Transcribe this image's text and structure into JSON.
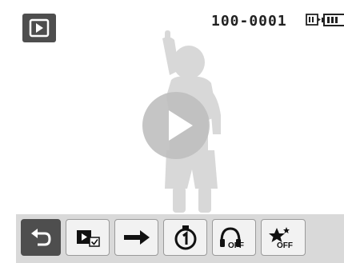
{
  "header": {
    "mode_icon": "play-mode-icon",
    "file_number": "100-0001",
    "storage_icon": "internal-memory-icon",
    "battery_icon": "battery-icon"
  },
  "preview": {
    "image": "child-silhouette",
    "play_icon": "play-icon"
  },
  "toolbar": {
    "items": [
      {
        "name": "back-button",
        "icon": "back-arrow-icon",
        "active": true
      },
      {
        "name": "slideshow-image-button",
        "icon": "image-select-icon"
      },
      {
        "name": "effect-button",
        "icon": "arrow-right-icon"
      },
      {
        "name": "interval-button",
        "icon": "timer-one-icon"
      },
      {
        "name": "music-button",
        "icon": "headphones-off-icon",
        "label": "OFF"
      },
      {
        "name": "transition-effect-button",
        "icon": "star-off-icon",
        "label": "OFF"
      }
    ]
  },
  "colors": {
    "active": "#4e4e4e",
    "toolbar_bg": "#d9d9d9",
    "button_bg": "#f2f2f2",
    "silhouette": "#d8d8d8",
    "play_overlay": "#bfbfbf"
  }
}
